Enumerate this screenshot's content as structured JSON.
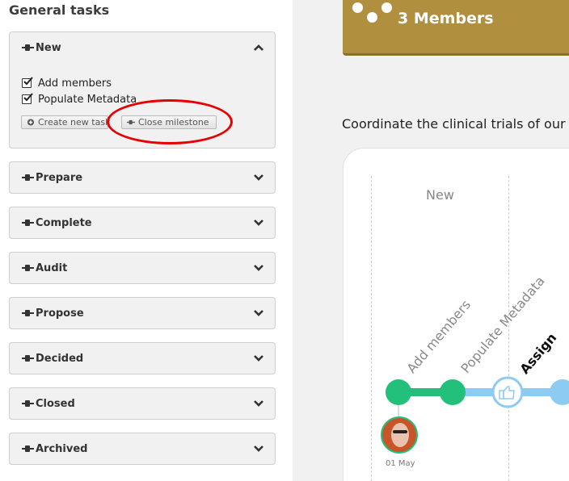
{
  "sidebar": {
    "title": "General tasks",
    "milestones": [
      {
        "label": "New",
        "expanded": true
      },
      {
        "label": "Prepare",
        "expanded": false
      },
      {
        "label": "Complete",
        "expanded": false
      },
      {
        "label": "Audit",
        "expanded": false
      },
      {
        "label": "Propose",
        "expanded": false
      },
      {
        "label": "Decided",
        "expanded": false
      },
      {
        "label": "Closed",
        "expanded": false
      },
      {
        "label": "Archived",
        "expanded": false
      }
    ],
    "tasks": [
      {
        "label": "Add members",
        "checked": true
      },
      {
        "label": "Populate Metadata",
        "checked": true
      }
    ],
    "create_task_label": "Create new task",
    "close_milestone_label": "Close milestone"
  },
  "banner": {
    "members_label": "3 Members",
    "color": "#b08f3f"
  },
  "description": "Coordinate the clinical trials of our ne",
  "timeline": {
    "stage_label": "New",
    "steps": [
      "Add members",
      "Populate Metadata",
      "Assign"
    ],
    "date": "01 May",
    "done_color": "#22c07a",
    "pending_color": "#8ecbf2"
  },
  "icons": [
    "pin-icon",
    "chevron-up-icon",
    "chevron-down-icon",
    "checkbox-checked-icon",
    "plus-circle-icon",
    "thumbs-up-icon",
    "avatar"
  ],
  "annotation_color": "#e60000"
}
